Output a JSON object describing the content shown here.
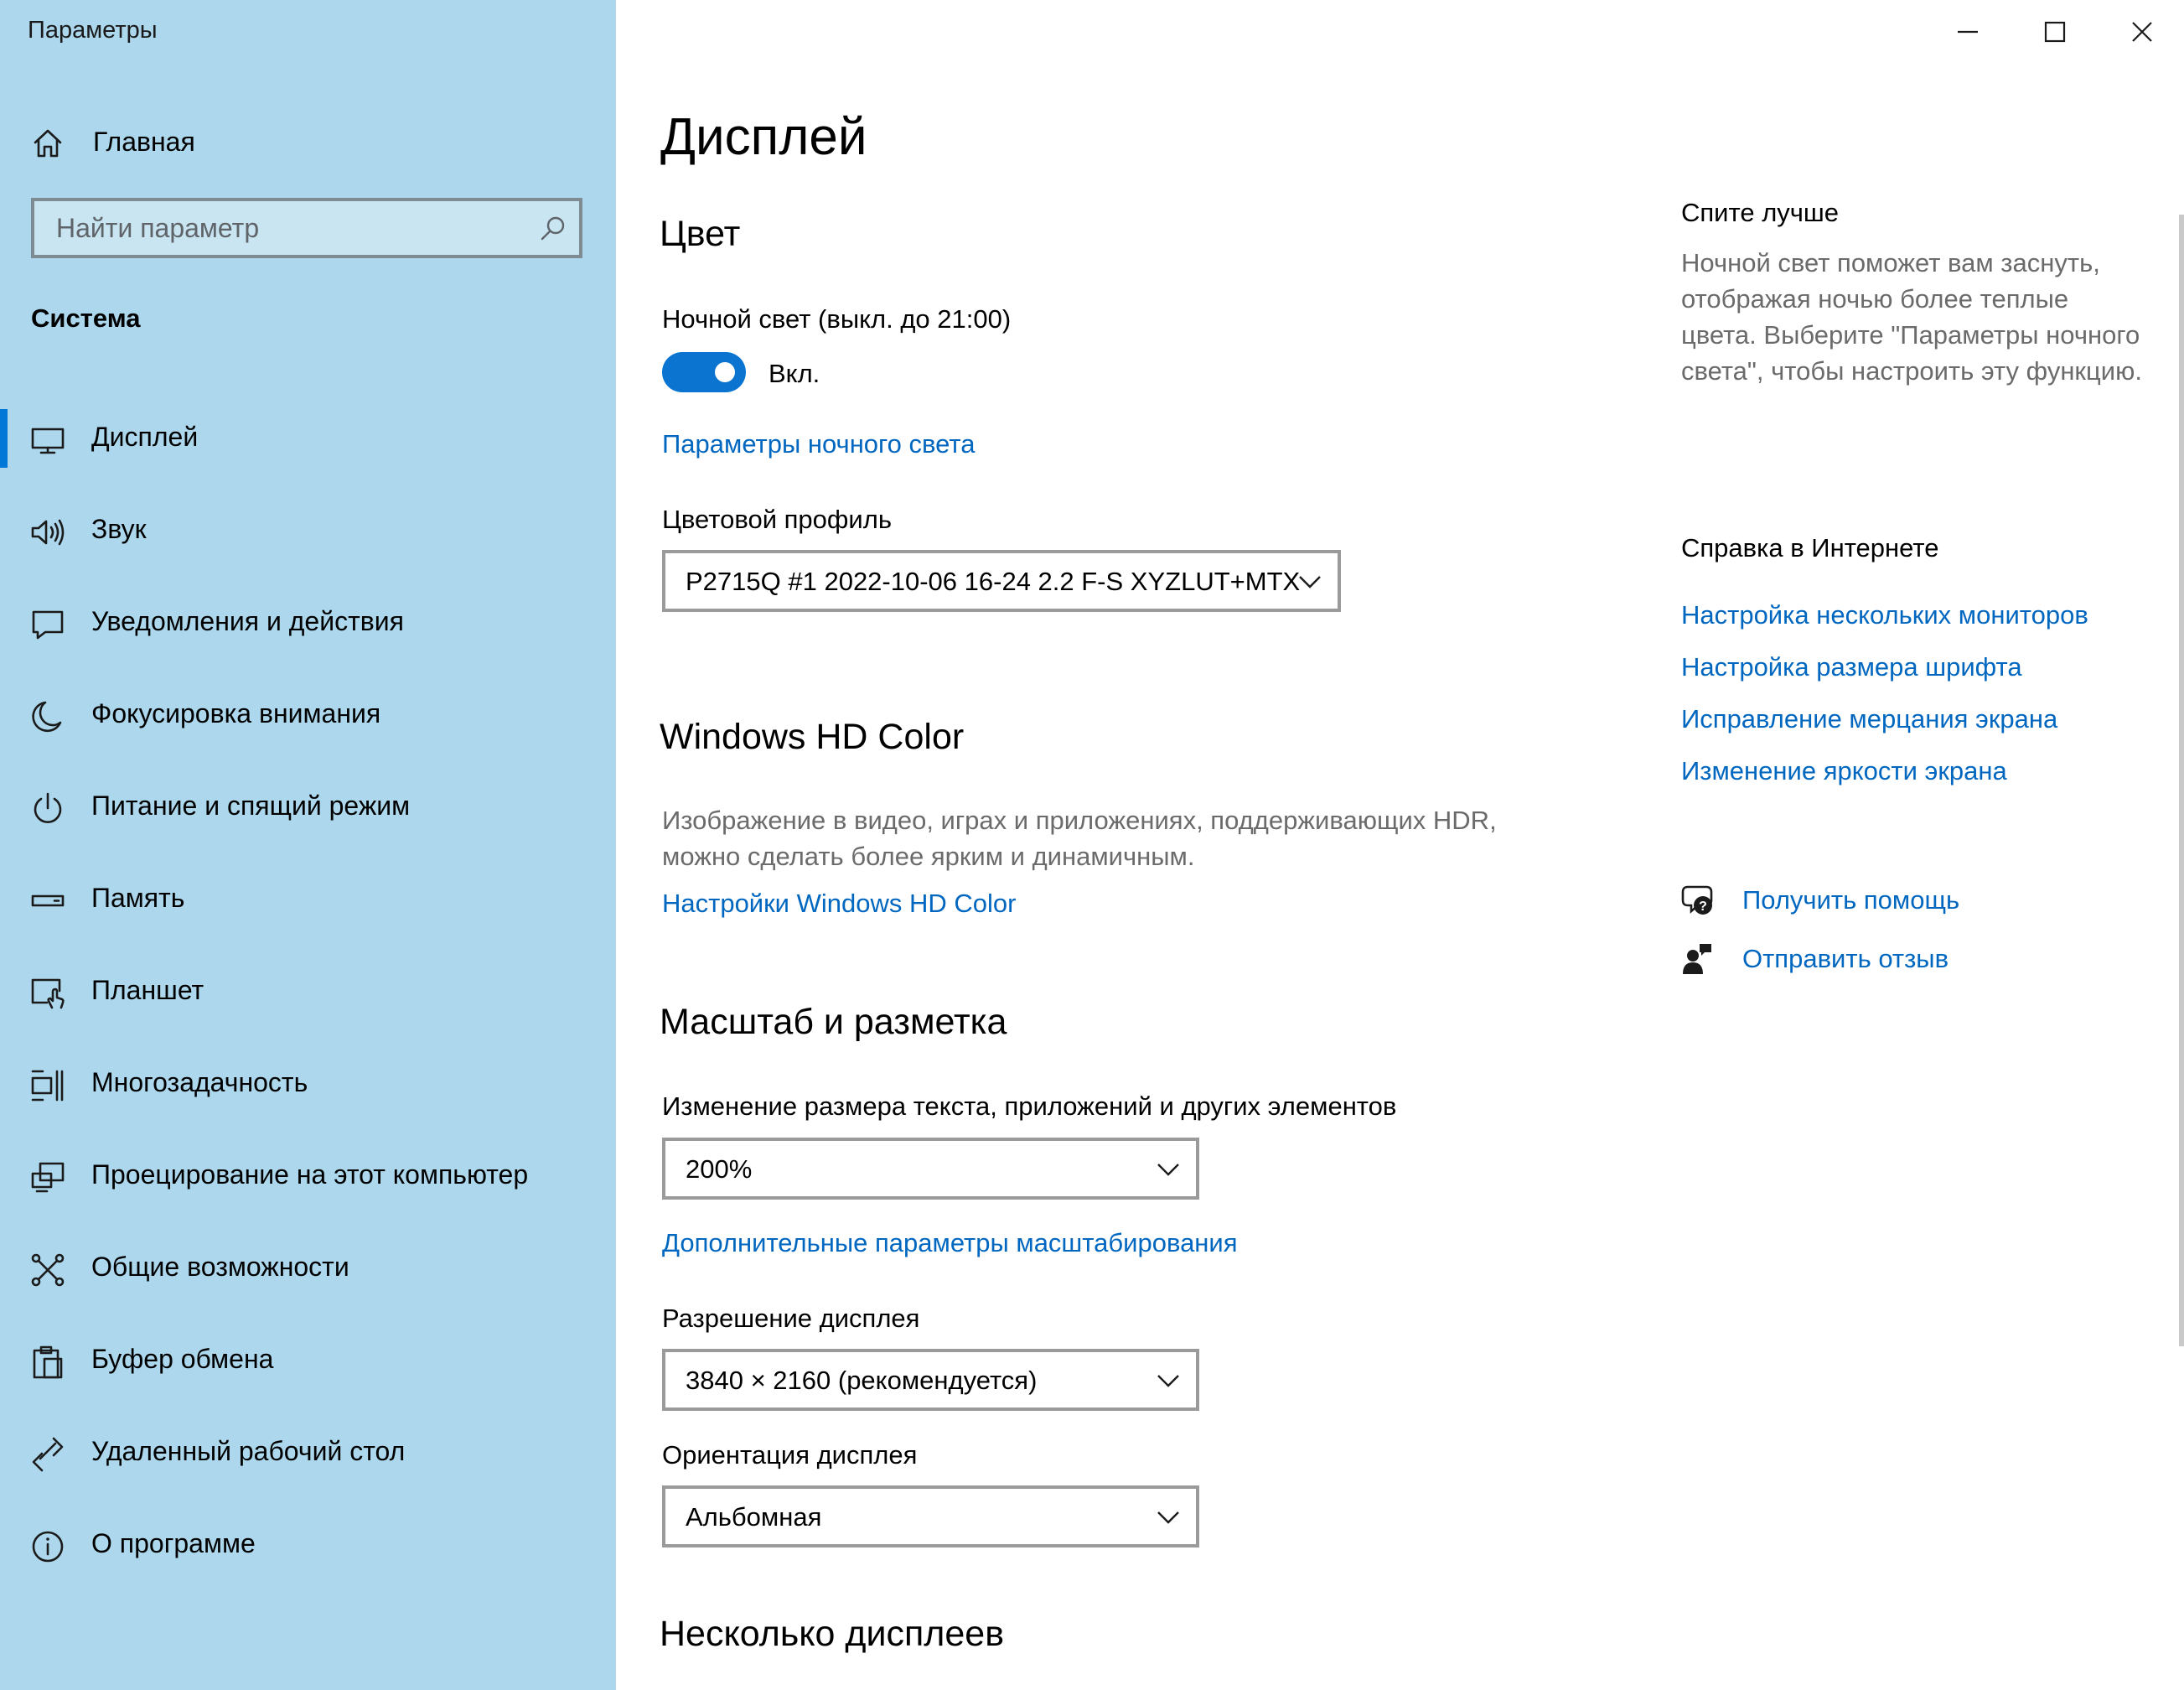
{
  "window": {
    "title": "Параметры",
    "minimize_icon": "minimize-icon",
    "maximize_icon": "maximize-icon",
    "close_icon": "close-icon"
  },
  "sidebar": {
    "home_label": "Главная",
    "search_placeholder": "Найти параметр",
    "group_title": "Система",
    "items": [
      {
        "label": "Дисплей",
        "icon": "monitor-icon",
        "active": true
      },
      {
        "label": "Звук",
        "icon": "speaker-icon"
      },
      {
        "label": "Уведомления и действия",
        "icon": "notification-icon"
      },
      {
        "label": "Фокусировка внимания",
        "icon": "moon-icon"
      },
      {
        "label": "Питание и спящий режим",
        "icon": "power-icon"
      },
      {
        "label": "Память",
        "icon": "storage-icon"
      },
      {
        "label": "Планшет",
        "icon": "tablet-icon"
      },
      {
        "label": "Многозадачность",
        "icon": "multitasking-icon"
      },
      {
        "label": "Проецирование на этот компьютер",
        "icon": "projecting-icon"
      },
      {
        "label": "Общие возможности",
        "icon": "shared-experiences-icon"
      },
      {
        "label": "Буфер обмена",
        "icon": "clipboard-icon"
      },
      {
        "label": "Удаленный рабочий стол",
        "icon": "remote-desktop-icon"
      },
      {
        "label": "О программе",
        "icon": "info-icon"
      }
    ]
  },
  "main": {
    "title": "Дисплей",
    "color": {
      "heading": "Цвет",
      "night_light_label": "Ночной свет (выкл. до 21:00)",
      "toggle_state": "Вкл.",
      "night_light_settings_link": "Параметры ночного света",
      "color_profile_label": "Цветовой профиль",
      "color_profile_value": "P2715Q #1 2022-10-06 16-24 2.2 F-S XYZLUT+MTX"
    },
    "hd_color": {
      "heading": "Windows HD Color",
      "description": "Изображение в видео, играх и приложениях, поддерживающих HDR, можно сделать более ярким и динамичным.",
      "link": "Настройки Windows HD Color"
    },
    "scale": {
      "heading": "Масштаб и разметка",
      "size_label": "Изменение размера текста, приложений и других элементов",
      "size_value": "200%",
      "advanced_link": "Дополнительные параметры масштабирования",
      "resolution_label": "Разрешение дисплея",
      "resolution_value": "3840 × 2160 (рекомендуется)",
      "orientation_label": "Ориентация дисплея",
      "orientation_value": "Альбомная"
    },
    "multiple_displays_heading": "Несколько дисплеев"
  },
  "right_panel": {
    "sleep_heading": "Спите лучше",
    "sleep_description": "Ночной свет поможет вам заснуть, отображая ночью более теплые цвета. Выберите \"Параметры ночного света\", чтобы настроить эту функцию.",
    "help_heading": "Справка в Интернете",
    "help_links": [
      "Настройка нескольких мониторов",
      "Настройка размера шрифта",
      "Исправление мерцания экрана",
      "Изменение яркости экрана"
    ],
    "get_help": "Получить помощь",
    "send_feedback": "Отправить отзыв"
  },
  "colors": {
    "sidebar_bg": "#acd7ec",
    "accent": "#0078d7",
    "link": "#0067c0"
  }
}
